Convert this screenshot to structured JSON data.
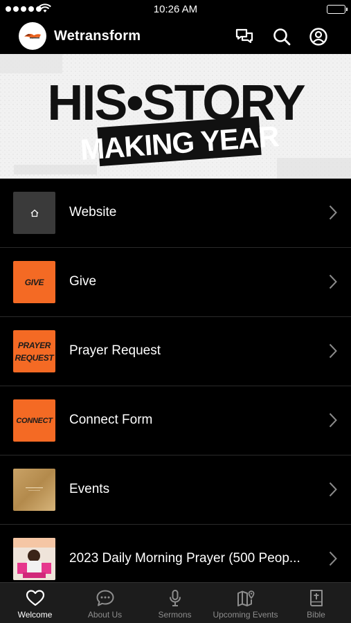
{
  "status_bar": {
    "time": "10:26 AM"
  },
  "header": {
    "title": "Wetransform"
  },
  "banner": {
    "line1": "HIS•STORY",
    "line2": "MAKING YEAR"
  },
  "menu": {
    "items": [
      {
        "label": "Website",
        "thumb_text": ""
      },
      {
        "label": "Give",
        "thumb_text": "GIVE"
      },
      {
        "label": "Prayer Request",
        "thumb_text_1": "PRAYER",
        "thumb_text_2": "REQUEST"
      },
      {
        "label": "Connect Form",
        "thumb_text": "CONNECT"
      },
      {
        "label": "Events",
        "thumb_text": ""
      },
      {
        "label": "2023 Daily Morning Prayer (500 Peop..."
      }
    ]
  },
  "tabs": [
    {
      "label": "Welcome",
      "icon": "heart-icon",
      "active": true
    },
    {
      "label": "About Us",
      "icon": "chat-bubble-icon",
      "active": false
    },
    {
      "label": "Sermons",
      "icon": "microphone-icon",
      "active": false
    },
    {
      "label": "Upcoming Events",
      "icon": "map-pin-icon",
      "active": false
    },
    {
      "label": "Bible",
      "icon": "bible-icon",
      "active": false
    }
  ],
  "colors": {
    "accent": "#f46a24",
    "background": "#000000",
    "tab_bar": "#1c1c1c"
  }
}
